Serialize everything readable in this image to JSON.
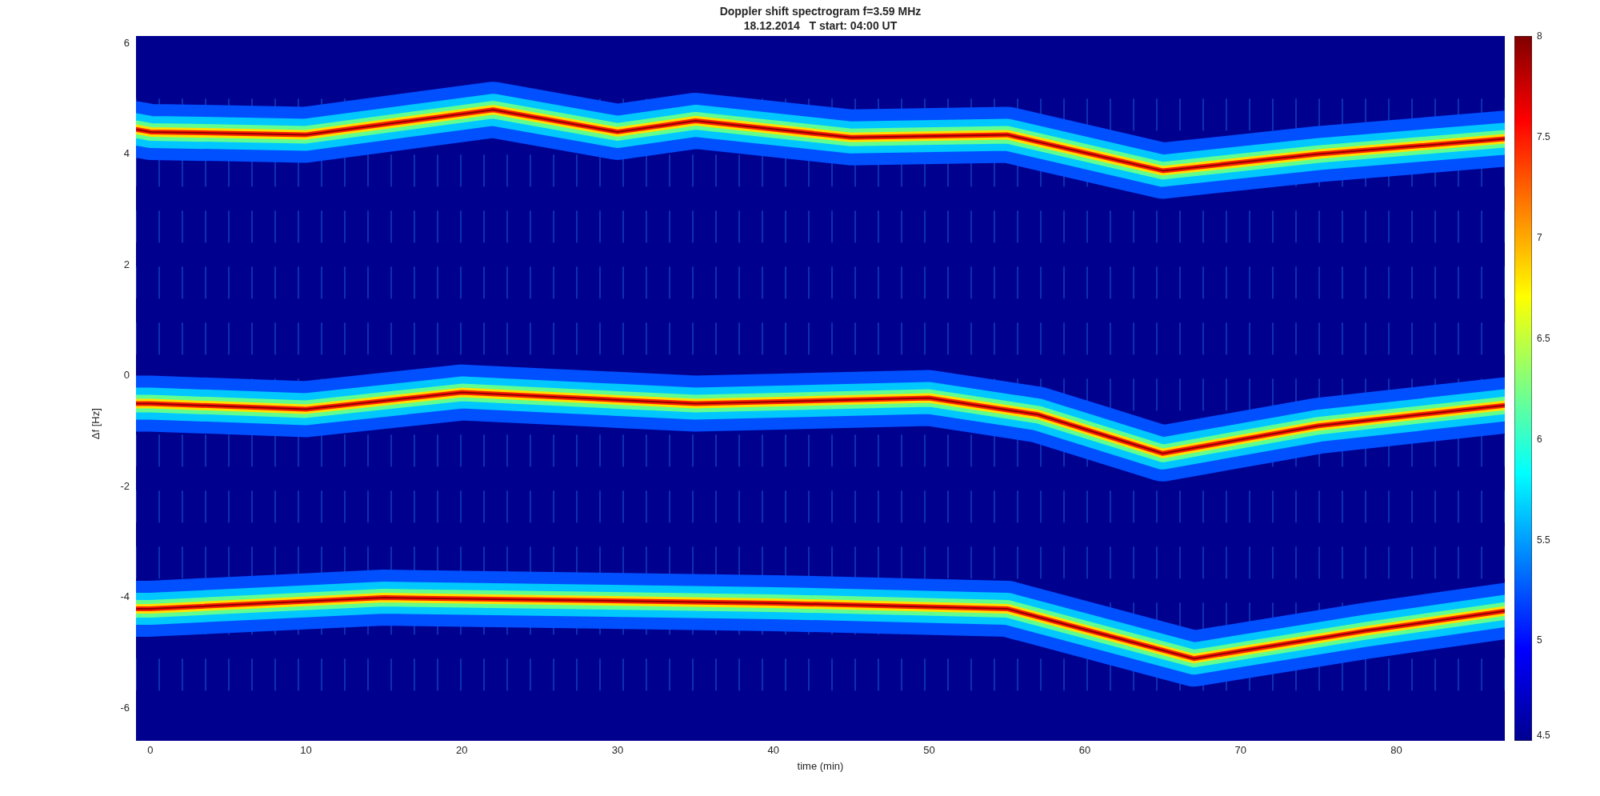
{
  "title": {
    "lines": [
      "Doppler shift spectrogram f=3.59 MHz",
      "18.12.2014   T start: 04:00 UT"
    ]
  },
  "axes": {
    "xlabel": "time (min)",
    "ylabel": "Δf [Hz]",
    "xticks": [
      "0",
      "10",
      "20",
      "30",
      "40",
      "50",
      "60",
      "70",
      "80"
    ],
    "yticks": [
      "6",
      "4",
      "2",
      "0",
      "-2",
      "-4",
      "-6"
    ]
  },
  "colorbar": {
    "ticks": [
      "8",
      "7.5",
      "7",
      "6.5",
      "6",
      "5.5",
      "5",
      "4.5"
    ]
  }
}
